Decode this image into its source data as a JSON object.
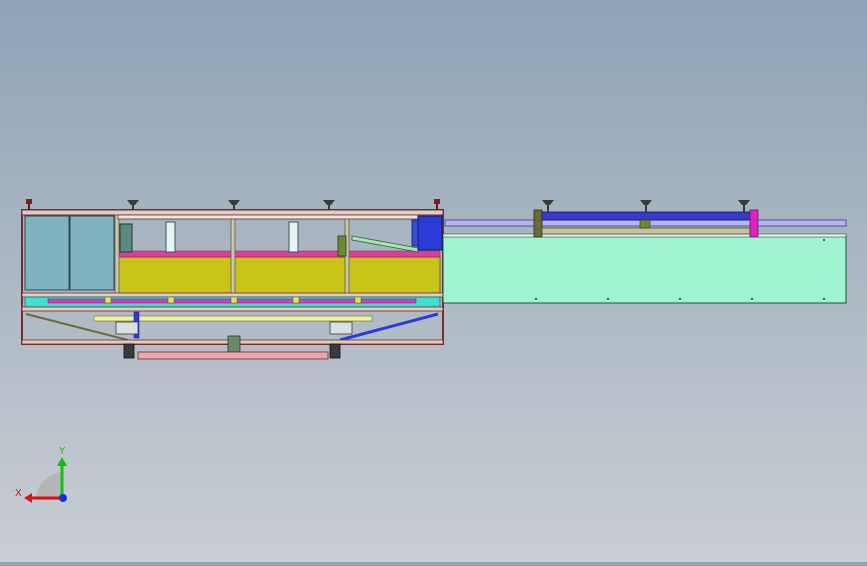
{
  "viewport": {
    "background_top": "#8fa3b8",
    "background_bottom": "#c9ced3"
  },
  "triad": {
    "x_label": "X",
    "y_label": "Y",
    "x_color": "#e01010",
    "y_color": "#10c010",
    "z_color": "#1030e0"
  },
  "colors": {
    "frame_outline": "#7a2a2a",
    "panel_teal": "#7fb3bf",
    "tank_yellow": "#c8c418",
    "conveyor_mint": "#9ef5cf",
    "rail_lavender": "#b8b4f0",
    "magenta": "#e020c0",
    "blue_motor": "#2a3cd8",
    "pink_bar": "#e8a8b0",
    "cyan_band": "#40e0d0",
    "cream_bar": "#f0f0a0",
    "olive": "#6a6a3a"
  }
}
